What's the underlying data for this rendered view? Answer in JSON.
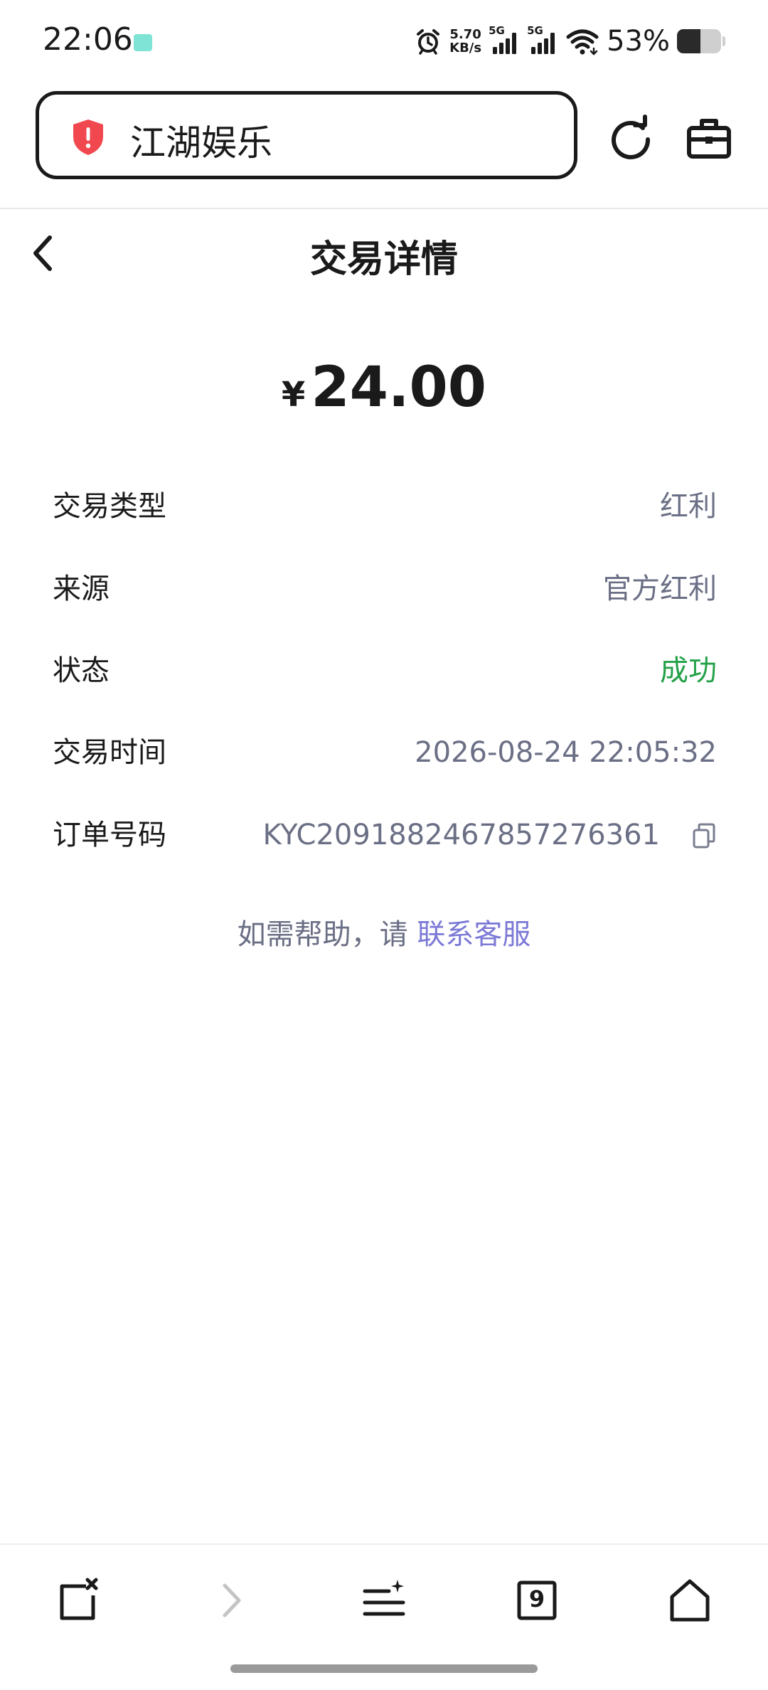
{
  "status_bar": {
    "time": "22:06",
    "net_speed_value": "5.70",
    "net_speed_unit": "KB/s",
    "signal_1_label": "5G",
    "signal_2_label": "5G",
    "battery_percent": "53%",
    "battery_level": 0.53
  },
  "browser": {
    "address_title": "江湖娱乐",
    "icons": {
      "security": "shield-alert-icon",
      "refresh": "refresh-icon",
      "toolbox": "toolbox-icon"
    }
  },
  "header": {
    "title": "交易详情"
  },
  "amount": {
    "currency": "¥",
    "value": "24.00"
  },
  "details": [
    {
      "label": "交易类型",
      "value": "红利"
    },
    {
      "label": "来源",
      "value": "官方红利"
    },
    {
      "label": "状态",
      "value": "成功"
    },
    {
      "label": "交易时间",
      "value": "2026-08-24 22:05:32"
    },
    {
      "label": "订单号码",
      "value": "KYC2091882467857276361"
    }
  ],
  "help": {
    "prefix": "如需帮助，请 ",
    "link": "联系客服"
  },
  "colors": {
    "success": "#24a148",
    "link": "#7b79d6",
    "muted": "#6b6f85",
    "danger": "#f0484e"
  }
}
